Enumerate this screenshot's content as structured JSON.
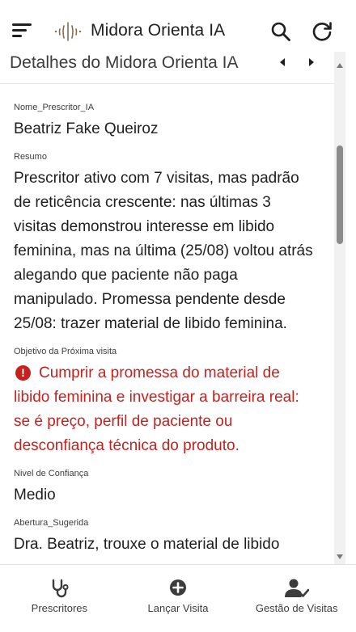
{
  "app": {
    "title": "Midora Orienta IA"
  },
  "panel": {
    "title": "Detalhes do Midora Orienta IA"
  },
  "fields": [
    {
      "label": "Nome_Prescritor_IA",
      "value": "Beatriz Fake Queiroz"
    },
    {
      "label": "Resumo",
      "value": "Prescritor ativo com 7 visitas, mas padrão de reticência crescente: nas últimas 3 visitas demonstrou interesse em libido feminina, mas na última (25/08) voltou atrás alegando que paciente não paga manipulado. Promessa pendente desde 25/08: trazer material de libido feminina."
    },
    {
      "label": "Objetivo da Próxima visita",
      "value": "Cumprir a promessa do material de libido feminina e investigar a barreira real: se é preço, perfil de paciente ou desconfiança técnica do produto.",
      "status": "error"
    },
    {
      "label": "Nivel de Confiança",
      "value": "Medio"
    },
    {
      "label": "Abertura_Sugerida",
      "value": "Dra. Beatriz, trouxe o material de libido"
    }
  ],
  "bottom_nav": [
    {
      "label": "Prescritores",
      "icon": "stethoscope-icon"
    },
    {
      "label": "Lançar Visita",
      "icon": "add-circle-icon"
    },
    {
      "label": "Gestão de Visitas",
      "icon": "person-check-icon"
    }
  ],
  "colors": {
    "error": "#c5221f",
    "text": "#1f1f1f",
    "label": "#3d3d3d"
  }
}
